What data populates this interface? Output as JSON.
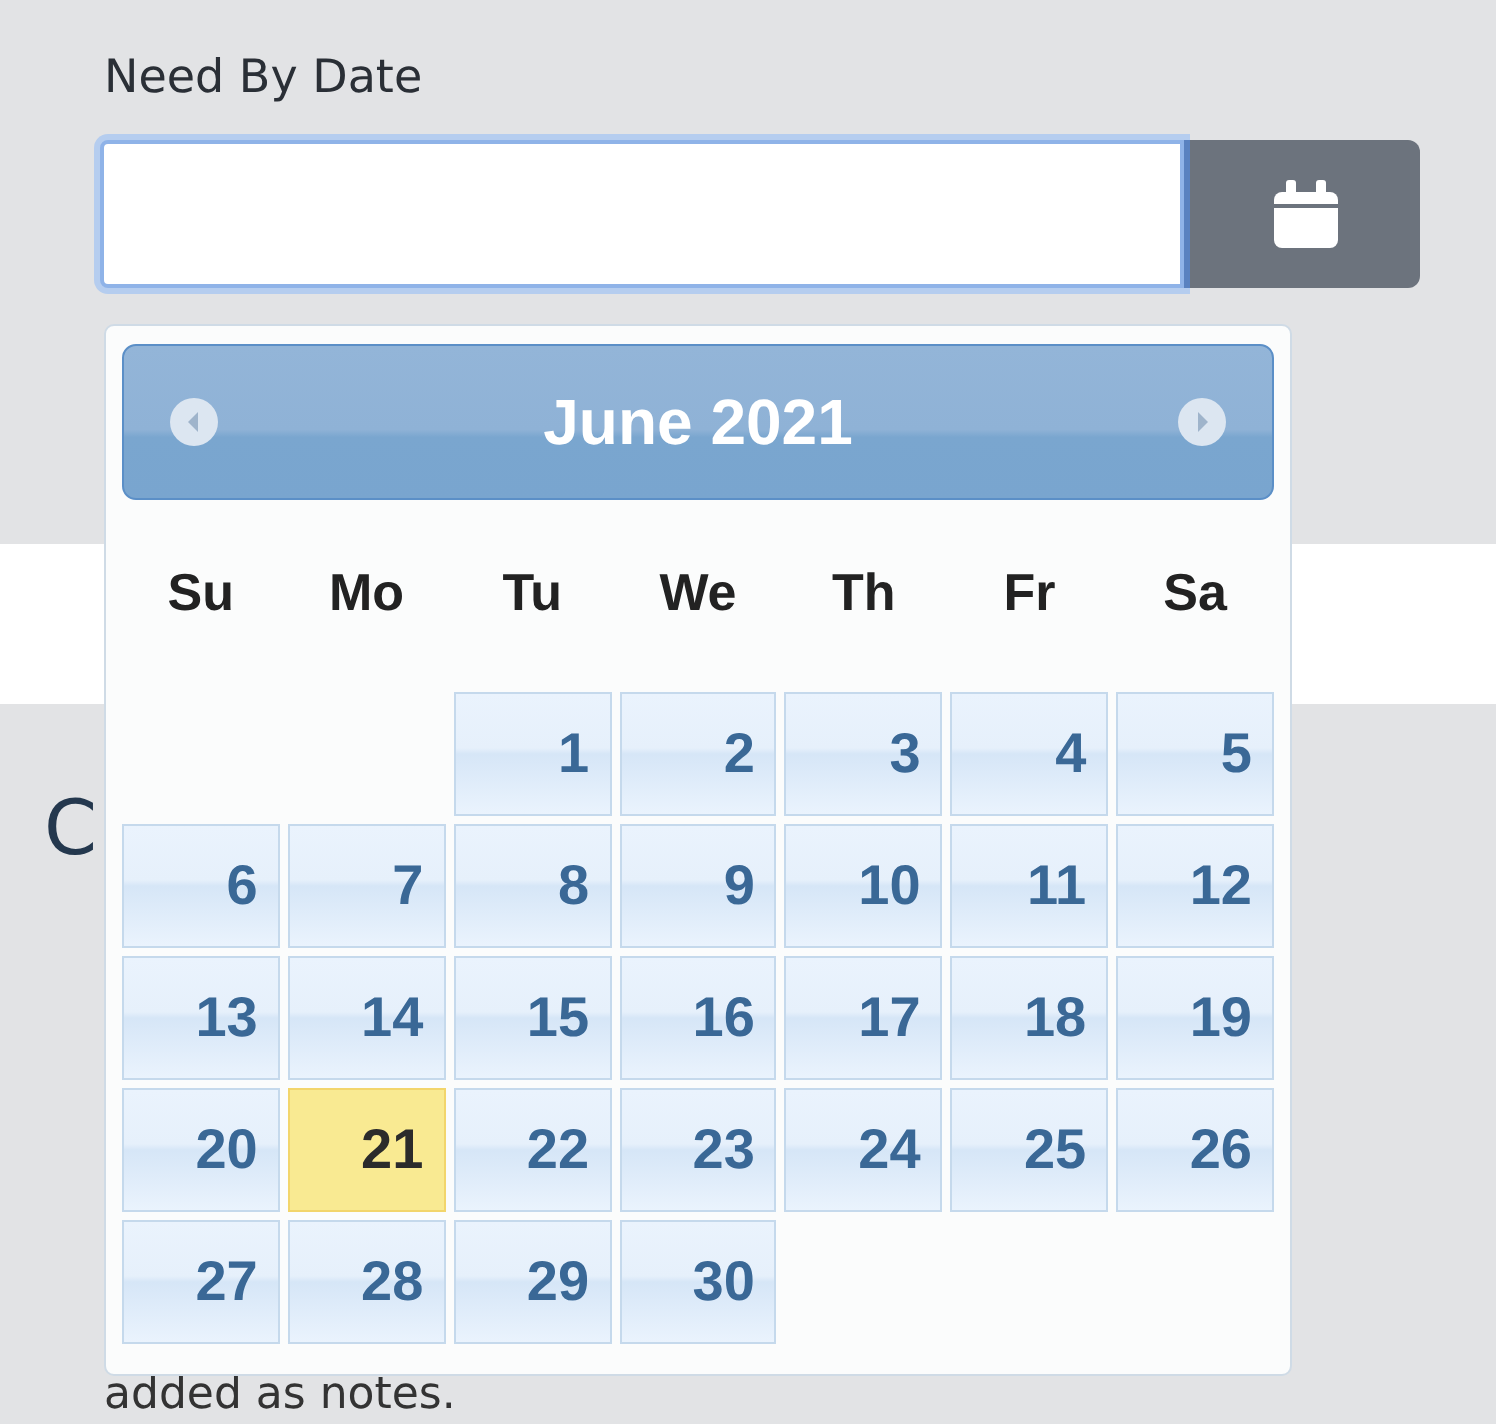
{
  "field": {
    "label": "Need By Date"
  },
  "datepicker": {
    "title": "June 2021",
    "weekdays": [
      "Su",
      "Mo",
      "Tu",
      "We",
      "Th",
      "Fr",
      "Sa"
    ],
    "weeks": [
      [
        {
          "label": "1",
          "selected": false
        },
        {
          "label": "2",
          "selected": false
        },
        {
          "label": "3",
          "selected": false
        },
        {
          "label": "4",
          "selected": false
        },
        {
          "label": "5",
          "selected": false
        }
      ],
      [
        {
          "label": "6",
          "selected": false
        },
        {
          "label": "7",
          "selected": false
        },
        {
          "label": "8",
          "selected": false
        },
        {
          "label": "9",
          "selected": false
        },
        {
          "label": "10",
          "selected": false
        },
        {
          "label": "11",
          "selected": false
        },
        {
          "label": "12",
          "selected": false
        }
      ],
      [
        {
          "label": "13",
          "selected": false
        },
        {
          "label": "14",
          "selected": false
        },
        {
          "label": "15",
          "selected": false
        },
        {
          "label": "16",
          "selected": false
        },
        {
          "label": "17",
          "selected": false
        },
        {
          "label": "18",
          "selected": false
        },
        {
          "label": "19",
          "selected": false
        }
      ],
      [
        {
          "label": "20",
          "selected": false
        },
        {
          "label": "21",
          "selected": true
        },
        {
          "label": "22",
          "selected": false
        },
        {
          "label": "23",
          "selected": false
        },
        {
          "label": "24",
          "selected": false
        },
        {
          "label": "25",
          "selected": false
        },
        {
          "label": "26",
          "selected": false
        }
      ],
      [
        {
          "label": "27",
          "selected": false
        },
        {
          "label": "28",
          "selected": false
        },
        {
          "label": "29",
          "selected": false
        },
        {
          "label": "30",
          "selected": false
        }
      ]
    ]
  },
  "section": {
    "heading": "C",
    "note": "added as notes."
  }
}
